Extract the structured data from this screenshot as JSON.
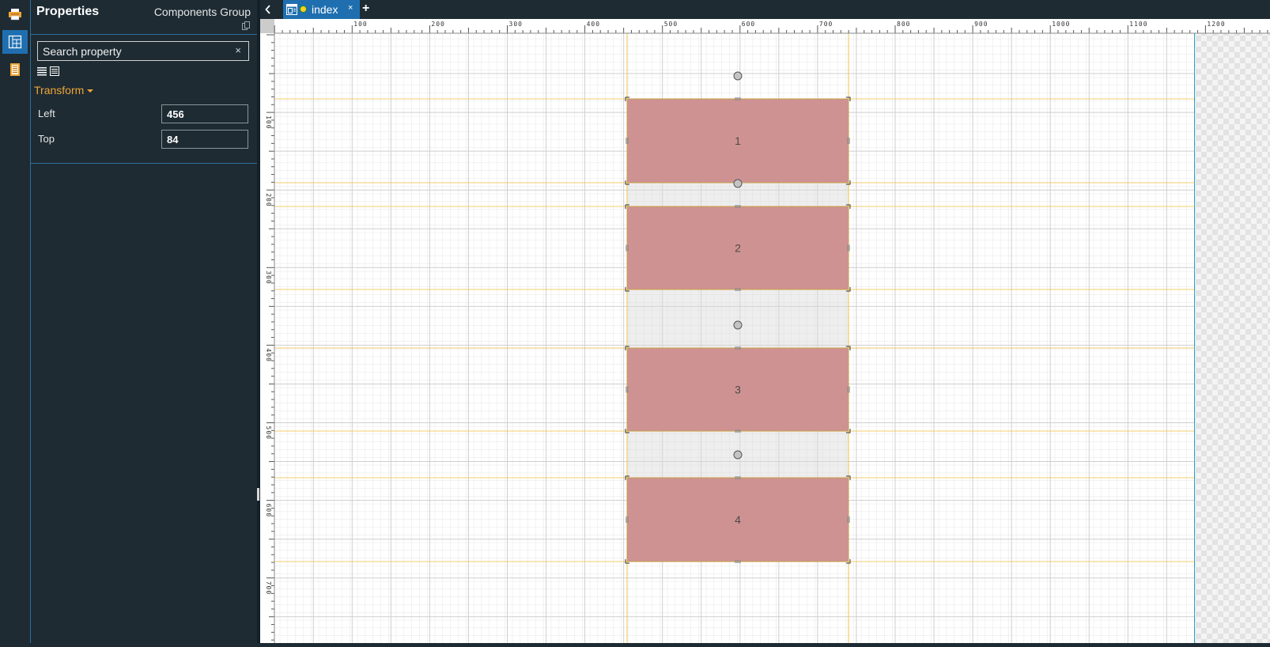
{
  "sidebar": {
    "icons": [
      "printer-icon",
      "properties-icon",
      "book-icon"
    ],
    "active": "properties-icon"
  },
  "panel": {
    "title": "Properties",
    "group": "Components Group",
    "search_placeholder": "Search property",
    "clear_icon": "×",
    "section": "Transform",
    "props": [
      {
        "label": "Left",
        "value": "456"
      },
      {
        "label": "Top",
        "value": "84"
      }
    ]
  },
  "tabs": [
    {
      "label": "index",
      "close": "×"
    }
  ],
  "add_tab": "+",
  "ruler": {
    "x_labels": [
      "100",
      "200",
      "300",
      "400",
      "500",
      "600",
      "700",
      "800",
      "900",
      "1000",
      "1100",
      "1200"
    ],
    "y_labels": [
      "100",
      "200",
      "300",
      "400",
      "500",
      "600",
      "700"
    ]
  },
  "components": [
    {
      "label": "1"
    },
    {
      "label": "2"
    },
    {
      "label": "3"
    },
    {
      "label": "4"
    }
  ],
  "colors": {
    "component_fill": "#cf9292",
    "guide": "#f1c34a",
    "accent": "#1f6fb0",
    "section": "#f0a637"
  }
}
